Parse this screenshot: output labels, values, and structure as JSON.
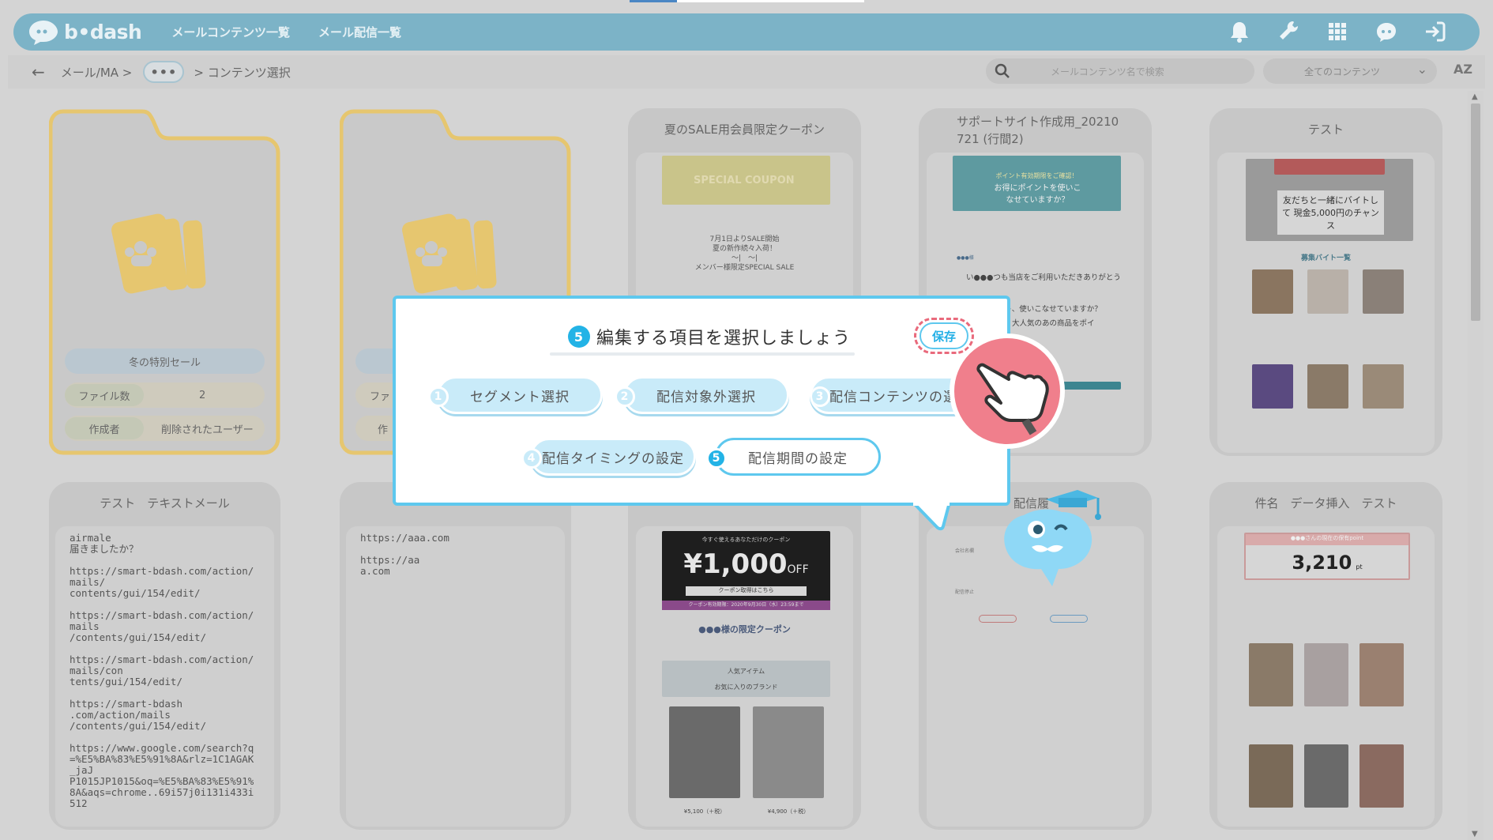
{
  "app": {
    "logo_text": "b•dash"
  },
  "nav": {
    "items": [
      "メールコンテンツ一覧",
      "メール配信一覧"
    ]
  },
  "header_icons": [
    "bell-icon",
    "wrench-icon",
    "grid-icon",
    "support-icon",
    "logout-icon"
  ],
  "breadcrumb": {
    "back": "←",
    "root": "メール/MA >",
    "ellipsis": "•••",
    "current": "> コンテンツ選択"
  },
  "search": {
    "placeholder": "メールコンテンツ名で検索"
  },
  "filter": {
    "selected": "全てのコンテンツ"
  },
  "sort": {
    "label": "AZ"
  },
  "folders": [
    {
      "name": "冬の特別セール",
      "files_label": "ファイル数",
      "files_value": "2",
      "author_label": "作成者",
      "author_value": "削除されたユーザー"
    },
    {
      "name": "",
      "files_label": "ファ",
      "files_value": "",
      "author_label": "作",
      "author_value": ""
    }
  ],
  "cards": [
    {
      "title": "夏のSALE用会員限定クーポン",
      "banner": "SPECIAL COUPON",
      "lines": [
        "7月1日よりSALE開始",
        "夏の新作続々入荷！",
        "〜|　〜|",
        "メンバー様限定SPECIAL SALE"
      ]
    },
    {
      "title": "サポートサイト作成用_20210721 (行間2)",
      "title_line1": "サポートサイト作成用_20210",
      "title_line2": "721 (行間2)",
      "banner_small": "ポイント有効期限をご確認！",
      "banner": "お得にポイントを使いこなせていますか？",
      "lines": [
        "●●●様",
        "い●●●つも当店をご利用いただきありがとう",
        "ポイント、使いこなせていますか？",
        "の商品、大人気のあの商品をポイ"
      ]
    },
    {
      "title": "テスト",
      "banner": "友だちと一緒にバイトして 現金5,000円のチャンス",
      "sub": "募集バイト一覧"
    },
    {
      "title": "テスト　テキストメール",
      "text": "airmale\n届きましたか？\n\nhttps://smart-bdash.com/action/\nmails/\ncontents/gui/154/edit/\n\nhttps://smart-bdash.com/action/\nmails\n/contents/gui/154/edit/\n\nhttps://smart-bdash.com/action/\nmails/con\ntents/gui/154/edit/\n\nhttps://smart-bdash\n.com/action/mails\n/contents/gui/154/edit/\n\nhttps://www.google.com/search?q\n=%E5%BA%83%E5%91%8A&rlz=1C1AGAK\n_jaJ\nP1015JP1015&oq=%E5%BA%83%E5%91%\n8A&aqs=chrome..69i57j0i131i433i\n512"
    },
    {
      "title": "",
      "text": "https://aaa.com\n\nhttps://aa\na.com"
    },
    {
      "title": "",
      "top": "今すぐ使えるあなただけのクーポン",
      "price": "¥1,000",
      "off": "OFF",
      "btn": "クーポン取得はこちら",
      "limit": "クーポン有効期限：2020年9月30日（水）23:59まで",
      "h2": "●●●様の限定クーポン",
      "section": "人気アイテム",
      "section2": "お気に入りのブランド",
      "p1": "¥5,100（＋税）",
      "p2": "¥4,900（＋税）"
    },
    {
      "title": "配信履",
      "lines": [
        "会社名欄",
        "配信停止"
      ]
    },
    {
      "title": "件名　データ挿入　テスト",
      "hdr": "●●●さんの現在の保有point",
      "points": "3,210",
      "unit": "pt"
    }
  ],
  "popup": {
    "step": "5",
    "title": "編集する項目を選択しましょう",
    "save": "保存",
    "options": [
      {
        "n": "1",
        "label": "セグメント選択",
        "selected": false
      },
      {
        "n": "2",
        "label": "配信対象外選択",
        "selected": false
      },
      {
        "n": "3",
        "label": "配信コンテンツの選",
        "selected": false
      },
      {
        "n": "4",
        "label": "配信タイミングの設定",
        "selected": false
      },
      {
        "n": "5",
        "label": "配信期間の設定",
        "selected": true
      }
    ]
  },
  "colors": {
    "accent": "#23b3e6",
    "popup_border": "#5ec8ee",
    "save_dash": "#e96a7c",
    "header": "#7cb3c7",
    "folder": "#e6c66f"
  }
}
